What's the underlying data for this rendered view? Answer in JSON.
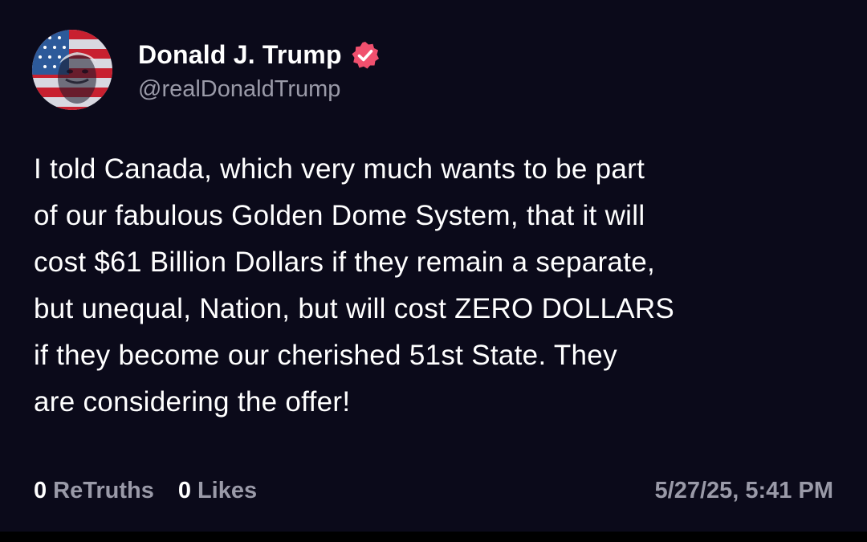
{
  "post": {
    "author": {
      "display_name": "Donald J. Trump",
      "handle": "@realDonaldTrump",
      "verified": true,
      "verified_badge_color": "#f0506e"
    },
    "body": "I told Canada, which very much wants to be part\nof our fabulous Golden Dome System, that it will\ncost $61 Billion Dollars if they remain a separate,\nbut unequal, Nation, but will cost ZERO DOLLARS\nif they become our cherished 51st State. They\nare considering the offer!",
    "stats": {
      "retruths_count": "0",
      "retruths_label": "ReTruths",
      "likes_count": "0",
      "likes_label": "Likes"
    },
    "timestamp": "5/27/25, 5:41 PM"
  },
  "colors": {
    "background": "#0b0a1a",
    "text_primary": "#ffffff",
    "text_secondary": "#9a9aa8"
  }
}
